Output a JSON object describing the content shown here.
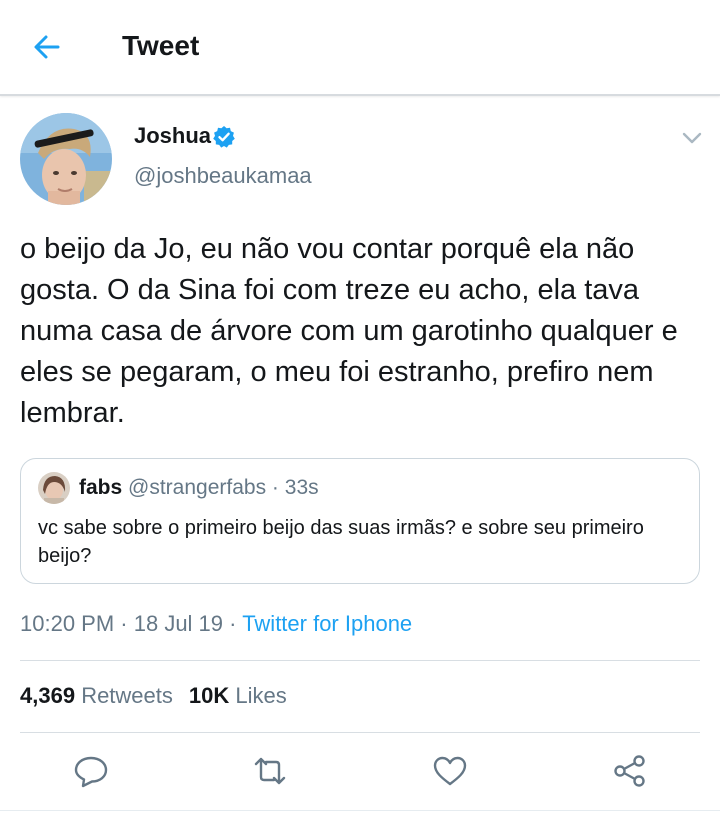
{
  "header": {
    "title": "Tweet",
    "back_icon": "arrow-left-icon"
  },
  "author": {
    "name": "Joshua",
    "handle": "@joshbeaukamaa",
    "verified": true
  },
  "tweet": {
    "text": "o beijo da Jo, eu não vou contar porquê ela não gosta. O da Sina foi com treze eu acho, ela tava numa casa de árvore com um garotinho qualquer e eles se pegaram, o meu foi estranho, prefiro nem lembrar.",
    "time": "10:20 PM",
    "date": "18 Jul 19",
    "separator": " · ",
    "source": "Twitter for Iphone"
  },
  "quoted": {
    "name": "fabs",
    "handle": "@strangerfabs",
    "age": "33s",
    "text": "vc sabe sobre o primeiro beijo das suas irmãs? e sobre seu primeiro beijo?"
  },
  "stats": {
    "retweets_count": "4,369",
    "retweets_label": "Retweets",
    "likes_count": "10K",
    "likes_label": "Likes"
  },
  "actions": [
    "reply-icon",
    "retweet-icon",
    "like-icon",
    "share-icon"
  ],
  "colors": {
    "accent": "#1da1f2",
    "secondary_text": "#657786",
    "text": "#14171a"
  }
}
